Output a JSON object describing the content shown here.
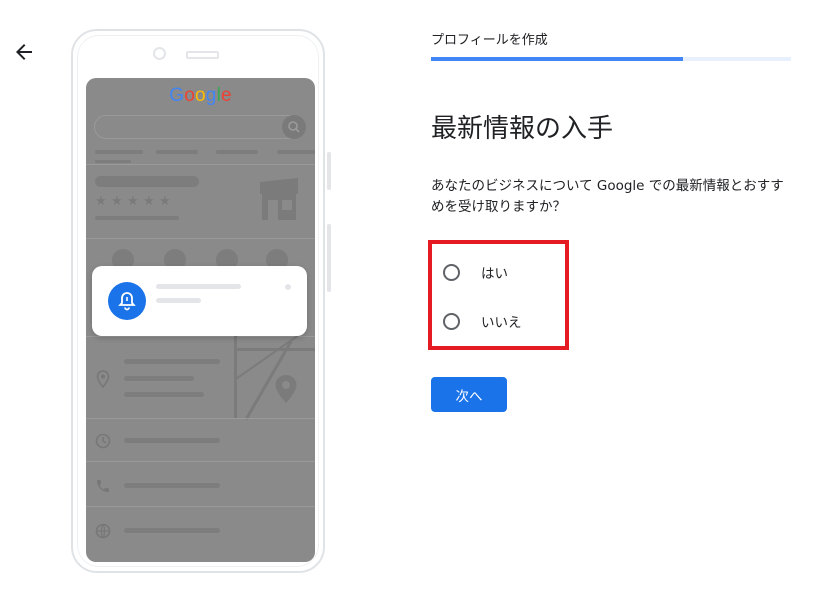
{
  "header": {
    "back_icon": "arrow-left-icon"
  },
  "illustration": {
    "brand_logo": "Google",
    "logo_colors": [
      "#4285f4",
      "#ea4335",
      "#fbbc05",
      "#4285f4",
      "#34a853",
      "#ea4335"
    ],
    "rating_stars": 5,
    "notification_icon": "bell-icon",
    "accent": "#1a73e8"
  },
  "progress": {
    "step_label": "プロフィールを作成",
    "value": 0.7
  },
  "main": {
    "title": "最新情報の入手",
    "description": "あなたのビジネスについて Google での最新情報とおすすめを受け取りますか？",
    "options": [
      {
        "label": "はい",
        "selected": false
      },
      {
        "label": "いいえ",
        "selected": false
      }
    ],
    "next_label": "次へ"
  },
  "colors": {
    "primary": "#1a73e8",
    "progress": "#4285f4",
    "highlight_box": "#e41b23"
  }
}
